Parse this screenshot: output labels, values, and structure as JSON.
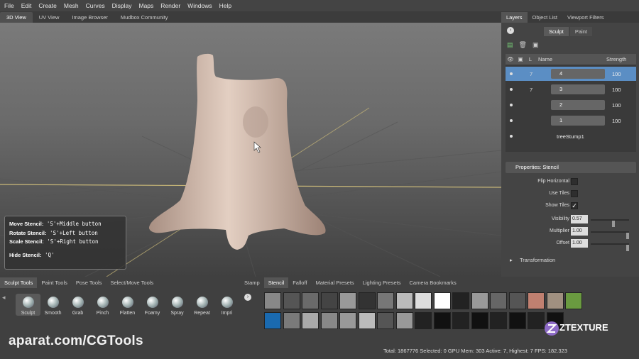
{
  "menu": [
    "File",
    "Edit",
    "Create",
    "Mesh",
    "Curves",
    "Display",
    "Maps",
    "Render",
    "Windows",
    "Help"
  ],
  "view_tabs": [
    "3D View",
    "UV View",
    "Image Browser",
    "Mudbox Community"
  ],
  "help": {
    "move_label": "Move Stencil:",
    "move_keys": "'S'+Middle button",
    "rotate_label": "Rotate Stencil:",
    "rotate_keys": "'S'+Left button",
    "scale_label": "Scale Stencil:",
    "scale_keys": "'S'+Right button",
    "hide_label": "Hide Stencil:",
    "hide_keys": "'Q'"
  },
  "right_tabs": [
    "Layers",
    "Object List",
    "Viewport Filters"
  ],
  "sub_tabs": [
    "Sculpt",
    "Paint"
  ],
  "layers": {
    "col_name": "Name",
    "col_strength": "Strength",
    "rows": [
      {
        "level": "7",
        "name": "4",
        "strength": "100"
      },
      {
        "level": "7",
        "name": "3",
        "strength": "100"
      },
      {
        "level": "",
        "name": "2",
        "strength": "100"
      },
      {
        "level": "",
        "name": "1",
        "strength": "100"
      },
      {
        "level": "",
        "name": "treeStump1",
        "strength": ""
      }
    ]
  },
  "properties": {
    "title": "Properties: Stencil",
    "flip_horizontal": "Flip Horizontal",
    "use_tiles": "Use Tiles",
    "show_tiles": "Show Tiles",
    "visibility_label": "Visibility",
    "visibility_value": "0.57",
    "multiplier_label": "Multiplier",
    "multiplier_value": "1.00",
    "offset_label": "Offset",
    "offset_value": "1.00",
    "transformation": "Transformation"
  },
  "tool_tabs": [
    "Sculpt Tools",
    "Paint Tools",
    "Pose Tools",
    "Select/Move Tools"
  ],
  "tools": [
    "Sculpt",
    "Smooth",
    "Grab",
    "Pinch",
    "Flatten",
    "Foamy",
    "Spray",
    "Repeat",
    "Impri"
  ],
  "stamp_tabs": [
    "Stamp",
    "Stencil",
    "Falloff",
    "Material Presets",
    "Lighting Presets",
    "Camera Bookmarks"
  ],
  "status": {
    "text": "Total: 1867776   Selected: 0 GPU Mem: 303   Active: 7, Highest: 7   FPS: 182.323"
  },
  "watermark": "aparat.com/CGTools",
  "logo_text": "ZTEXTURE",
  "colors": {
    "selection": "#5b8ec4",
    "stump": "#d9c3b4",
    "grid_line": "#c9b878"
  }
}
